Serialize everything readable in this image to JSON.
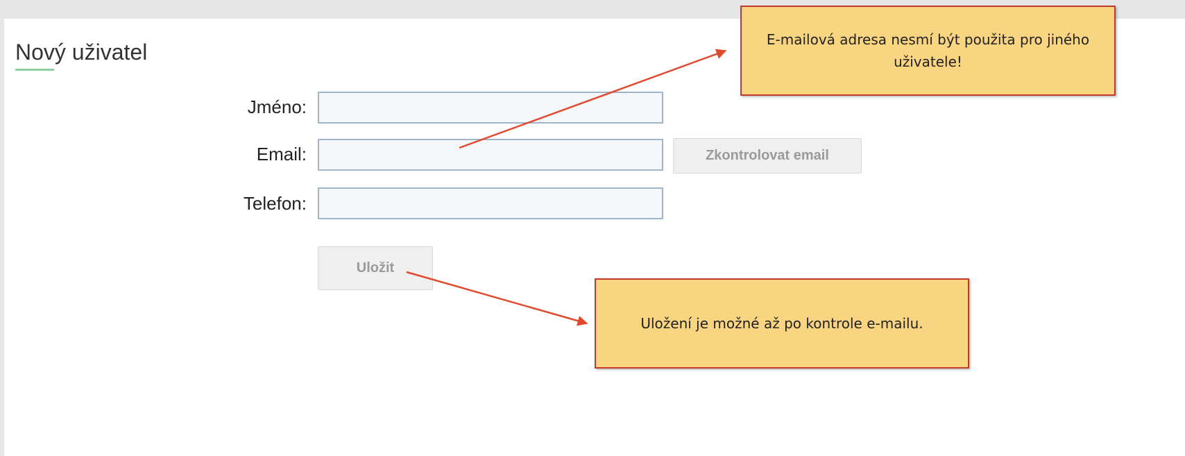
{
  "form": {
    "title": "Nový uživatel",
    "fields": [
      {
        "label": "Jméno:",
        "value": "",
        "placeholder": ""
      },
      {
        "label": "Email:",
        "value": "",
        "placeholder": ""
      },
      {
        "label": "Telefon:",
        "value": "",
        "placeholder": ""
      }
    ],
    "check_email_label": "Zkontrolovat email",
    "save_label": "Uložit"
  },
  "callouts": {
    "email_note": "E-mailová adresa nesmí být použita pro jiného uživatele!",
    "save_note": "Uložení je možné až po kontrole e-mailu."
  },
  "colors": {
    "callout_fill": "#fad581",
    "callout_border": "#c0392b",
    "arrow": "#e04a2f",
    "title_underline": "#8fd19e"
  }
}
